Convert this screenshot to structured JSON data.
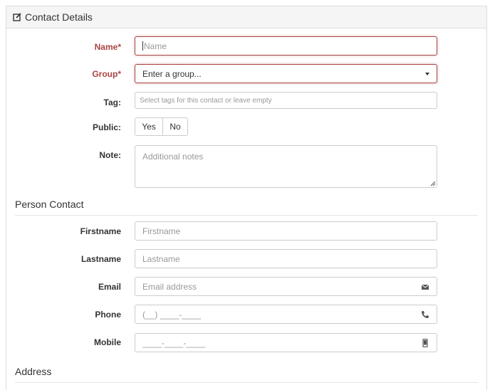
{
  "panel": {
    "title": "Contact Details"
  },
  "form": {
    "name": {
      "label": "Name*",
      "placeholder": "Name"
    },
    "group": {
      "label": "Group*",
      "placeholder": "Enter a group..."
    },
    "tag": {
      "label": "Tag:",
      "placeholder": "Select tags for this contact or leave empty"
    },
    "public": {
      "label": "Public:",
      "yes": "Yes",
      "no": "No"
    },
    "note": {
      "label": "Note:",
      "placeholder": "Additional notes"
    }
  },
  "person_contact": {
    "title": "Person Contact",
    "firstname": {
      "label": "Firstname",
      "placeholder": "Firstname"
    },
    "lastname": {
      "label": "Lastname",
      "placeholder": "Lastname"
    },
    "email": {
      "label": "Email",
      "placeholder": "Email address",
      "icon": "envelope-icon"
    },
    "phone": {
      "label": "Phone",
      "placeholder": "(__) ____-____",
      "icon": "phone-icon"
    },
    "mobile": {
      "label": "Mobile",
      "placeholder": "____-____-____",
      "icon": "mobile-icon"
    }
  },
  "address": {
    "title": "Address"
  },
  "colors": {
    "required": "#a94442",
    "border": "#cccccc",
    "placeholder": "#999999"
  }
}
